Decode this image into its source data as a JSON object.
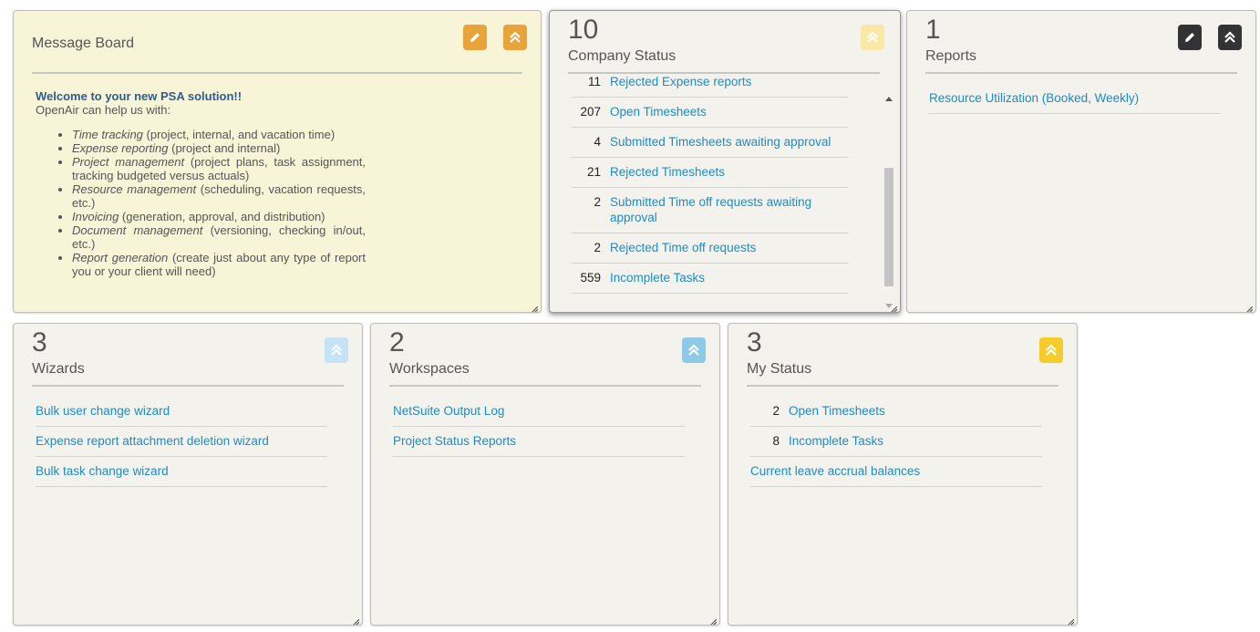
{
  "message_board": {
    "title": "Message Board",
    "welcome": "Welcome to your new PSA solution!!",
    "intro": "OpenAir can help us with:",
    "items": [
      {
        "term": "Time tracking",
        "desc": " (project, internal, and vacation time)"
      },
      {
        "term": "Expense reporting",
        "desc": " (project and internal)"
      },
      {
        "term": "Project management",
        "desc": " (project plans, task assignment, tracking budgeted versus actuals)"
      },
      {
        "term": "Resource management",
        "desc": " (scheduling, vacation requests, etc.)"
      },
      {
        "term": "Invoicing",
        "desc": " (generation, approval, and distribution)"
      },
      {
        "term": "Document management",
        "desc": " (versioning, checking in/out, etc.)"
      },
      {
        "term": "Report generation",
        "desc": " (create just about any type of report you or your client will need)"
      }
    ]
  },
  "company_status": {
    "count": "10",
    "title": "Company Status",
    "partial_item": {
      "num": "11",
      "label": "Rejected Expense reports"
    },
    "items": [
      {
        "num": "207",
        "label": "Open Timesheets"
      },
      {
        "num": "4",
        "label": "Submitted Timesheets awaiting approval"
      },
      {
        "num": "21",
        "label": "Rejected Timesheets"
      },
      {
        "num": "2",
        "label": "Submitted Time off requests awaiting approval"
      },
      {
        "num": "2",
        "label": "Rejected Time off requests"
      },
      {
        "num": "559",
        "label": "Incomplete Tasks"
      }
    ]
  },
  "reports": {
    "count": "1",
    "title": "Reports",
    "items": [
      "Resource Utilization (Booked, Weekly)"
    ]
  },
  "wizards": {
    "count": "3",
    "title": "Wizards",
    "items": [
      "Bulk user change wizard",
      "Expense report attachment deletion wizard",
      "Bulk task change wizard"
    ]
  },
  "workspaces": {
    "count": "2",
    "title": "Workspaces",
    "items": [
      "NetSuite Output Log",
      "Project Status Reports"
    ]
  },
  "my_status": {
    "count": "3",
    "title": "My Status",
    "items": [
      {
        "num": "2",
        "label": "Open Timesheets"
      },
      {
        "num": "8",
        "label": "Incomplete Tasks"
      }
    ],
    "extra": "Current leave accrual balances"
  },
  "colors": {
    "orange": "#e8a33a",
    "dark": "#333333",
    "pale_yellow": "#fbe8a6",
    "pale_blue": "#c4e4f6",
    "blue": "#8fc9e8",
    "yellow": "#f5cc2a",
    "link": "#1e8cc4"
  }
}
